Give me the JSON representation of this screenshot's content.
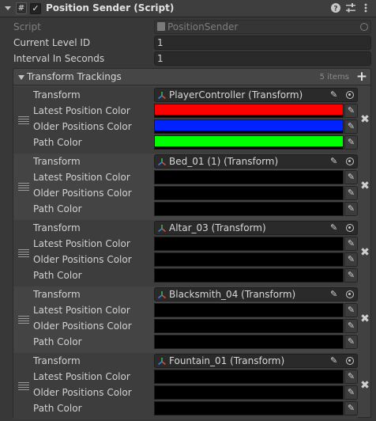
{
  "component": {
    "title": "Position Sender (Script)",
    "enabled_mark": "✓",
    "script_icon_glyph": "#",
    "header_icons": [
      "help-icon",
      "presets-icon",
      "more-icon"
    ]
  },
  "properties": {
    "script_label": "Script",
    "script_value": "PositionSender",
    "level_label": "Current Level ID",
    "level_value": "1",
    "interval_label": "Interval In Seconds",
    "interval_value": "1"
  },
  "list": {
    "title": "Transform Trackings",
    "count": "5 items",
    "add_glyph": "+",
    "remove_glyph": "✖",
    "labels": {
      "transform": "Transform",
      "latest": "Latest Position Color",
      "older": "Older Positions Color",
      "path": "Path Color"
    },
    "elements": [
      {
        "transform": "PlayerController (Transform)",
        "latest_color": "#ff0000",
        "older_color": "#0022ff",
        "path_color": "#00ff00"
      },
      {
        "transform": "Bed_01 (1) (Transform)",
        "latest_color": "#000000",
        "older_color": "#000000",
        "path_color": "#000000"
      },
      {
        "transform": "Altar_03 (Transform)",
        "latest_color": "#000000",
        "older_color": "#000000",
        "path_color": "#000000"
      },
      {
        "transform": "Blacksmith_04 (Transform)",
        "latest_color": "#000000",
        "older_color": "#000000",
        "path_color": "#000000"
      },
      {
        "transform": "Fountain_01 (Transform)",
        "latest_color": "#000000",
        "older_color": "#000000",
        "path_color": "#000000"
      }
    ]
  }
}
